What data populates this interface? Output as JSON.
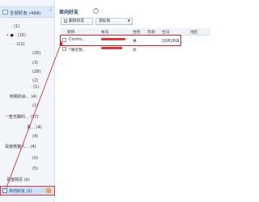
{
  "sidebar": {
    "all_friends_label": "全部好友 (468)",
    "groups": [
      {
        "label": ". (1)"
      },
      {
        "label": "• ● · (15)"
      },
      {
        "label": "· · (12)"
      },
      {
        "label": "(20)"
      },
      {
        "label": "(3)"
      },
      {
        "label": "(28)"
      },
      {
        "label": "(2)"
      },
      {
        "label": "· (1)"
      },
      {
        "label": "刺桐的会... (4)"
      },
      {
        "label": "(1)"
      },
      {
        "label": "一筐无聊的... (37)"
      },
      {
        "label": "· 菫... (4)"
      },
      {
        "label": "(4)"
      },
      {
        "label": "百度熊猫人... (4)"
      },
      {
        "label": "(0)"
      },
      {
        "label": "(5)"
      },
      {
        "label": "百度网页 (0)"
      }
    ],
    "selected_item": {
      "label": "单向好友 (2)"
    }
  },
  "main": {
    "title": "单向好友",
    "help_icon": "question-icon",
    "toolbar": {
      "delete_label": "删除好友",
      "add_label": "添加到"
    },
    "table": {
      "columns": [
        "昵称",
        "帐号",
        "性别",
        "年龄",
        "生日",
        "地区"
      ],
      "rows": [
        {
          "nickname": "Contro...",
          "gender": "男",
          "birthday": "10月26日"
        },
        {
          "nickname": "*语伦敦...",
          "gender": "女",
          "birthday": ""
        }
      ]
    }
  },
  "colors": {
    "highlight_red": "#c0262c",
    "redaction_red": "#d8393b",
    "sidebar_bg": "#f2f5f9",
    "selected_bg": "#cfe0f4"
  }
}
